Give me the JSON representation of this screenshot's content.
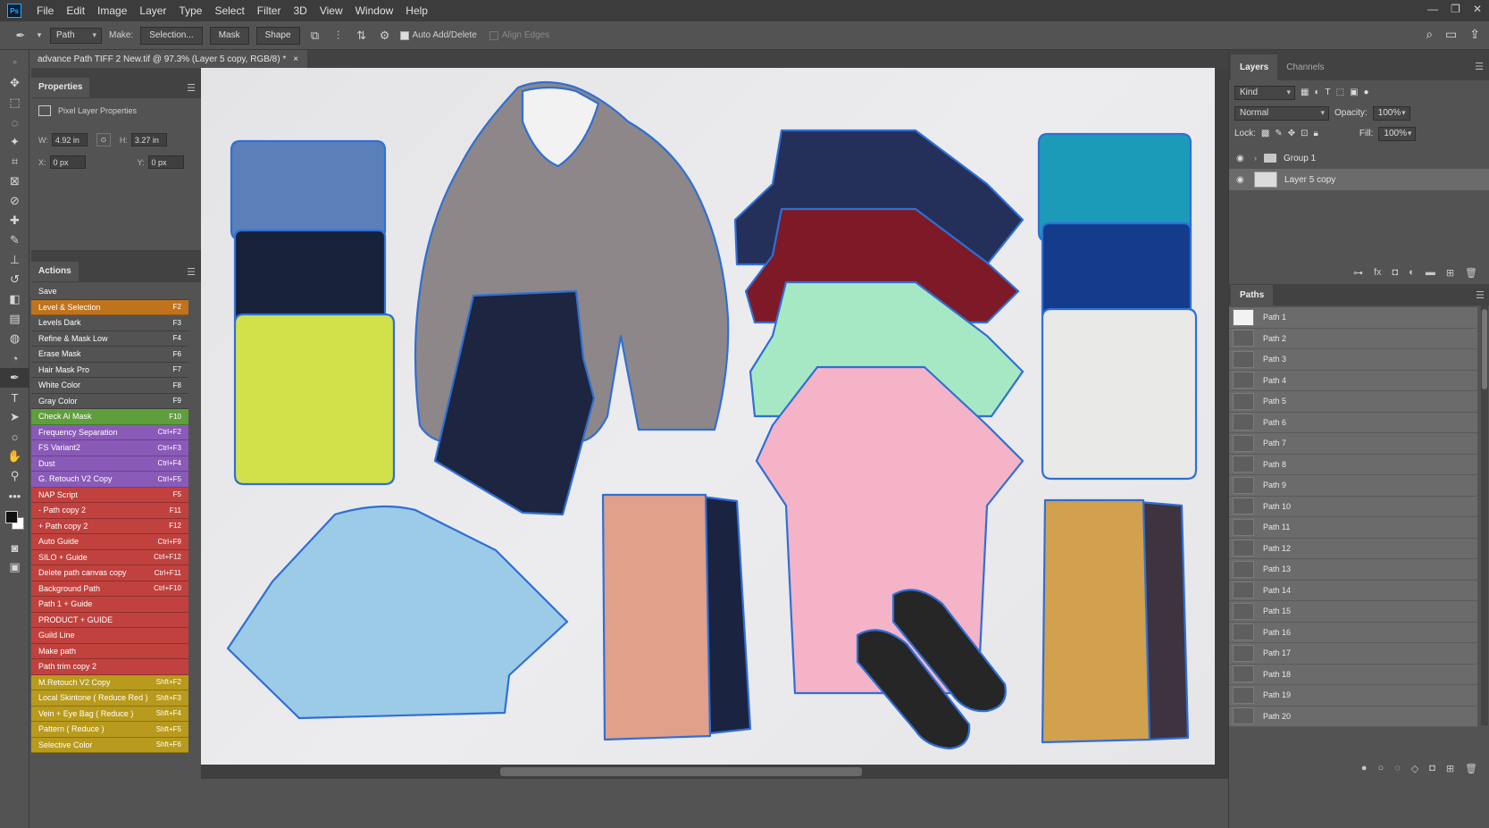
{
  "app": {
    "logo": "Ps",
    "menu": [
      "File",
      "Edit",
      "Image",
      "Layer",
      "Type",
      "Select",
      "Filter",
      "3D",
      "View",
      "Window",
      "Help"
    ],
    "window_controls": [
      "—",
      "❐",
      "✕"
    ]
  },
  "options_bar": {
    "mode_value": "Path",
    "make_label": "Make:",
    "selection_button": "Selection...",
    "mask_button": "Mask",
    "shape_button": "Shape",
    "auto_add_delete": "Auto Add/Delete",
    "align_edges": "Align Edges"
  },
  "document": {
    "tab_title": "advance Path TIFF 2 New.tif @ 97.3% (Layer 5 copy, RGB/8) *",
    "close_glyph": "×"
  },
  "properties": {
    "title": "Properties",
    "subtitle": "Pixel Layer Properties",
    "w_label": "W:",
    "w_value": "4.92 in",
    "h_label": "H:",
    "h_value": "3.27 in",
    "x_label": "X:",
    "x_value": "0 px",
    "y_label": "Y:",
    "y_value": "0 px"
  },
  "actions": {
    "title": "Actions",
    "items": [
      {
        "label": "Save",
        "key": "",
        "color": "#535353"
      },
      {
        "label": "Level & Selection",
        "key": "F2",
        "color": "#c0731d"
      },
      {
        "label": "Levels  Dark",
        "key": "F3",
        "color": "#535353"
      },
      {
        "label": "Refine & Mask Low",
        "key": "F4",
        "color": "#535353"
      },
      {
        "label": "Erase Mask",
        "key": "F6",
        "color": "#535353"
      },
      {
        "label": "Hair Mask Pro",
        "key": "F7",
        "color": "#535353"
      },
      {
        "label": "White Color",
        "key": "F8",
        "color": "#535353"
      },
      {
        "label": "Gray Color",
        "key": "F9",
        "color": "#535353"
      },
      {
        "label": "Check Ai Mask",
        "key": "F10",
        "color": "#5f9e3d"
      },
      {
        "label": "Frequency Separation",
        "key": "Ctrl+F2",
        "color": "#8a5ab8"
      },
      {
        "label": "FS Variant2",
        "key": "Ctrl+F3",
        "color": "#8a5ab8"
      },
      {
        "label": "Dust",
        "key": "Ctrl+F4",
        "color": "#8a5ab8"
      },
      {
        "label": "G. Retouch V2 Copy",
        "key": "Ctrl+F5",
        "color": "#8a5ab8"
      },
      {
        "label": "NAP Script",
        "key": "F5",
        "color": "#c0413d"
      },
      {
        "label": "- Path copy 2",
        "key": "F11",
        "color": "#c0413d"
      },
      {
        "label": "+ Path copy 2",
        "key": "F12",
        "color": "#c0413d"
      },
      {
        "label": "Auto Guide",
        "key": "Ctrl+F9",
        "color": "#c0413d"
      },
      {
        "label": "SILO + Guide",
        "key": "Ctrl+F12",
        "color": "#c0413d"
      },
      {
        "label": "Delete path canvas copy",
        "key": "Ctrl+F11",
        "color": "#c0413d"
      },
      {
        "label": "Background Path",
        "key": "Ctrl+F10",
        "color": "#c0413d"
      },
      {
        "label": "Path 1 + Guide",
        "key": "",
        "color": "#c0413d"
      },
      {
        "label": "PRODUCT + GUIDE",
        "key": "",
        "color": "#c0413d"
      },
      {
        "label": "Guild Line",
        "key": "",
        "color": "#c0413d"
      },
      {
        "label": "Make path",
        "key": "",
        "color": "#c0413d"
      },
      {
        "label": "Path trim copy 2",
        "key": "",
        "color": "#c0413d"
      },
      {
        "label": "M.Retouch V2 Copy",
        "key": "Shft+F2",
        "color": "#b89a1c"
      },
      {
        "label": "Local Skintone ( Reduce Red )",
        "key": "Shft+F3",
        "color": "#b89a1c"
      },
      {
        "label": "Vein + Eye Bag ( Reduce  )",
        "key": "Shft+F4",
        "color": "#b89a1c"
      },
      {
        "label": "Pattern ( Reduce )",
        "key": "Shft+F5",
        "color": "#b89a1c"
      },
      {
        "label": "Selective Color",
        "key": "Shft+F6",
        "color": "#b89a1c"
      }
    ]
  },
  "layers": {
    "tabs": [
      "Layers",
      "Channels"
    ],
    "kind_value": "Kind",
    "blend_value": "Normal",
    "opacity_label": "Opacity:",
    "opacity_value": "100%",
    "lock_label": "Lock:",
    "fill_label": "Fill:",
    "fill_value": "100%",
    "items": [
      {
        "name": "Group 1",
        "type": "group"
      },
      {
        "name": "Layer 5 copy",
        "type": "pixel"
      }
    ]
  },
  "paths": {
    "title": "Paths",
    "items": [
      "Path 1",
      "Path 2",
      "Path 3",
      "Path 4",
      "Path 5",
      "Path 6",
      "Path 7",
      "Path 8",
      "Path 9",
      "Path 10",
      "Path 11",
      "Path 12",
      "Path 13",
      "Path 14",
      "Path 15",
      "Path 16",
      "Path 17",
      "Path 18",
      "Path 19",
      "Path 20"
    ]
  },
  "canvas_colors": {
    "path_stroke": "#2f6fd6",
    "sweater_blue": "#5b7fb8",
    "sweater_navy": "#17213a",
    "sweater_lime": "#d2e04a",
    "sweater_gray": "#8d8789",
    "polo_navy": "#24305a",
    "polo_maroon": "#7e1a28",
    "polo_mint": "#a6e8c4",
    "polo_pink": "#f5b3c7",
    "tee_teal": "#1c9bb8",
    "tee_royal": "#153c8c",
    "tee_white": "#e9e9e7",
    "shirt_lightblue": "#9ccbe8",
    "shorts_salmon": "#e0a089",
    "shorts_navy": "#1a2340",
    "shorts_khaki": "#d2a14d",
    "shorts_plum": "#3e3440",
    "pants_navy": "#1d2540",
    "sneaker_black": "#262626"
  }
}
